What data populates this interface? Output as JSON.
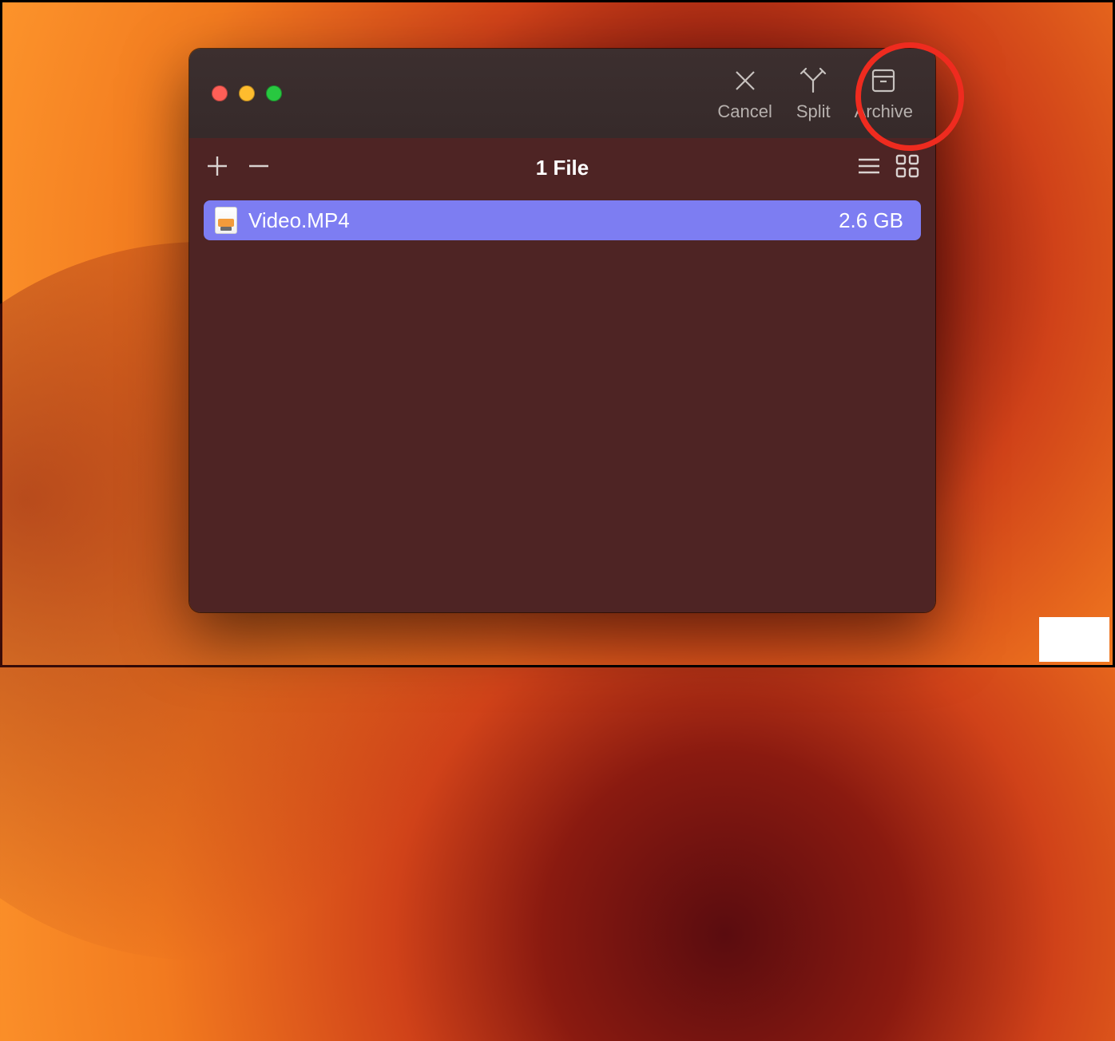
{
  "toolbar": {
    "cancel_label": "Cancel",
    "split_label": "Split",
    "archive_label": "Archive"
  },
  "subbar": {
    "file_count": "1 File"
  },
  "files": [
    {
      "name": "Video.MP4",
      "size": "2.6 GB"
    }
  ]
}
